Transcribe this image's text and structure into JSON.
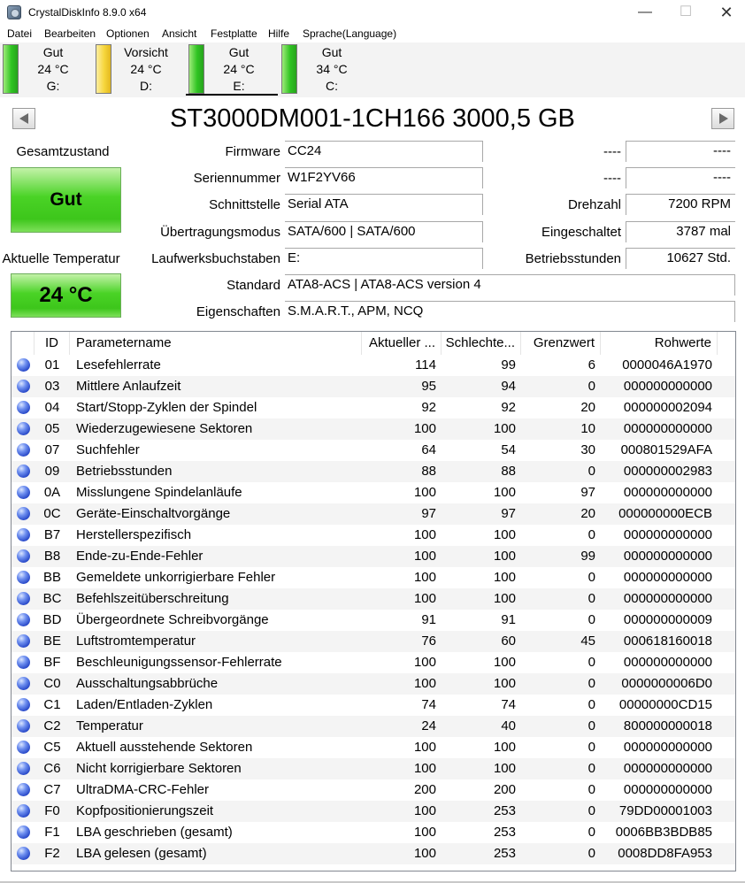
{
  "window": {
    "title": "CrystalDiskInfo 8.9.0 x64"
  },
  "menu": [
    "Datei",
    "Bearbeiten",
    "Optionen",
    "Ansicht",
    "Festplatte",
    "Hilfe",
    "Sprache(Language)"
  ],
  "disks": [
    {
      "status": "Gut",
      "temp": "24 °C",
      "letter": "G:",
      "color": "green",
      "active": false
    },
    {
      "status": "Vorsicht",
      "temp": "24 °C",
      "letter": "D:",
      "color": "yellow",
      "active": false
    },
    {
      "status": "Gut",
      "temp": "24 °C",
      "letter": "E:",
      "color": "green",
      "active": true
    },
    {
      "status": "Gut",
      "temp": "34 °C",
      "letter": "C:",
      "color": "green",
      "active": false
    }
  ],
  "drive": {
    "title": "ST3000DM001-1CH166 3000,5 GB"
  },
  "health": {
    "label": "Gesamtzustand",
    "status": "Gut"
  },
  "temperature": {
    "label": "Aktuelle Temperatur",
    "value": "24 °C"
  },
  "info": [
    {
      "label": "Firmware",
      "value": "CC24"
    },
    {
      "label": "Seriennummer",
      "value": "W1F2YV66"
    },
    {
      "label": "Schnittstelle",
      "value": "Serial ATA"
    },
    {
      "label": "Übertragungsmodus",
      "value": "SATA/600 | SATA/600"
    },
    {
      "label": "Laufwerksbuchstaben",
      "value": "E:"
    },
    {
      "label": "Standard",
      "value": "ATA8-ACS | ATA8-ACS version 4"
    },
    {
      "label": "Eigenschaften",
      "value": "S.M.A.R.T., APM, NCQ"
    }
  ],
  "right_info": [
    {
      "label": "----",
      "value": "----"
    },
    {
      "label": "----",
      "value": "----"
    },
    {
      "label": "Drehzahl",
      "value": "7200 RPM"
    },
    {
      "label": "Eingeschaltet",
      "value": "3787 mal"
    },
    {
      "label": "Betriebsstunden",
      "value": "10627 Std."
    }
  ],
  "smart": {
    "columns": [
      "ID",
      "Parametername",
      "Aktueller ...",
      "Schlechte...",
      "Grenzwert",
      "Rohwerte"
    ],
    "rows": [
      [
        "01",
        "Lesefehlerrate",
        "114",
        "99",
        "6",
        "0000046A1970"
      ],
      [
        "03",
        "Mittlere Anlaufzeit",
        "95",
        "94",
        "0",
        "000000000000"
      ],
      [
        "04",
        "Start/Stopp-Zyklen der Spindel",
        "92",
        "92",
        "20",
        "000000002094"
      ],
      [
        "05",
        "Wiederzugewiesene Sektoren",
        "100",
        "100",
        "10",
        "000000000000"
      ],
      [
        "07",
        "Suchfehler",
        "64",
        "54",
        "30",
        "000801529AFA"
      ],
      [
        "09",
        "Betriebsstunden",
        "88",
        "88",
        "0",
        "000000002983"
      ],
      [
        "0A",
        "Misslungene Spindelanläufe",
        "100",
        "100",
        "97",
        "000000000000"
      ],
      [
        "0C",
        "Geräte-Einschaltvorgänge",
        "97",
        "97",
        "20",
        "000000000ECB"
      ],
      [
        "B7",
        "Herstellerspezifisch",
        "100",
        "100",
        "0",
        "000000000000"
      ],
      [
        "B8",
        "Ende-zu-Ende-Fehler",
        "100",
        "100",
        "99",
        "000000000000"
      ],
      [
        "BB",
        "Gemeldete unkorrigierbare Fehler",
        "100",
        "100",
        "0",
        "000000000000"
      ],
      [
        "BC",
        "Befehlszeitüberschreitung",
        "100",
        "100",
        "0",
        "000000000000"
      ],
      [
        "BD",
        "Übergeordnete Schreibvorgänge",
        "91",
        "91",
        "0",
        "000000000009"
      ],
      [
        "BE",
        "Luftstromtemperatur",
        "76",
        "60",
        "45",
        "000618160018"
      ],
      [
        "BF",
        "Beschleunigungssensor-Fehlerrate",
        "100",
        "100",
        "0",
        "000000000000"
      ],
      [
        "C0",
        "Ausschaltungsabbrüche",
        "100",
        "100",
        "0",
        "0000000006D0"
      ],
      [
        "C1",
        "Laden/Entladen-Zyklen",
        "74",
        "74",
        "0",
        "00000000CD15"
      ],
      [
        "C2",
        "Temperatur",
        "24",
        "40",
        "0",
        "800000000018"
      ],
      [
        "C5",
        "Aktuell ausstehende Sektoren",
        "100",
        "100",
        "0",
        "000000000000"
      ],
      [
        "C6",
        "Nicht korrigierbare Sektoren",
        "100",
        "100",
        "0",
        "000000000000"
      ],
      [
        "C7",
        "UltraDMA-CRC-Fehler",
        "200",
        "200",
        "0",
        "000000000000"
      ],
      [
        "F0",
        "Kopfpositionierungszeit",
        "100",
        "253",
        "0",
        "79DD00001003"
      ],
      [
        "F1",
        "LBA geschrieben (gesamt)",
        "100",
        "253",
        "0",
        "0006BB3BDB85"
      ],
      [
        "F2",
        "LBA gelesen (gesamt)",
        "100",
        "253",
        "0",
        "0008DD8FA953"
      ]
    ]
  }
}
